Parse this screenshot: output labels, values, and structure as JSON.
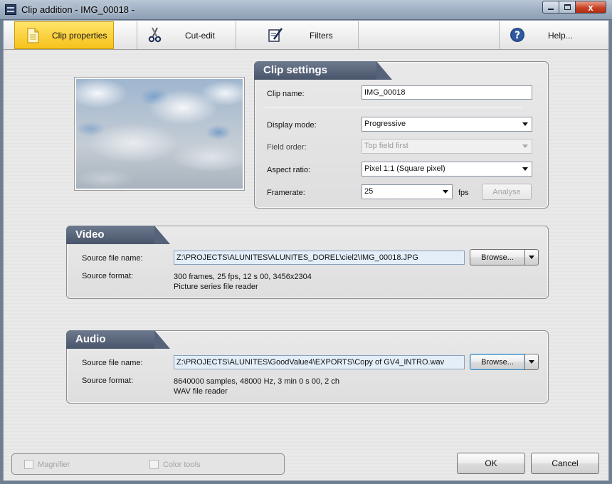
{
  "window": {
    "title": "Clip addition - IMG_00018 -",
    "icon": "app-icon",
    "controls": {
      "minimize": "minimize-icon",
      "maximize": "maximize-icon",
      "close": "x"
    }
  },
  "tabs": {
    "clip_properties": {
      "label": "Clip properties",
      "icon": "document-icon",
      "active": true
    },
    "cut_edit": {
      "label": "Cut-edit",
      "icon": "scissors-icon"
    },
    "filters": {
      "label": "Filters",
      "icon": "pen-icon"
    },
    "help": {
      "label": "Help...",
      "icon": "help-icon"
    }
  },
  "clip_settings": {
    "header": "Clip settings",
    "clip_name_label": "Clip name:",
    "clip_name_value": "IMG_00018",
    "display_mode_label": "Display mode:",
    "display_mode_value": "Progressive",
    "field_order_label": "Field order:",
    "field_order_value": "Top field first",
    "aspect_ratio_label": "Aspect ratio:",
    "aspect_ratio_value": "Pixel 1:1 (Square pixel)",
    "framerate_label": "Framerate:",
    "framerate_value": "25",
    "fps_unit": "fps",
    "analyse_label": "Analyse"
  },
  "video": {
    "header": "Video",
    "source_file_label": "Source file name:",
    "source_file_value": "Z:\\PROJECTS\\ALUNITES\\ALUNITES_DOREL\\ciel2\\IMG_00018.JPG",
    "browse_label": "Browse...",
    "source_format_label": "Source format:",
    "source_format_line1": "300  frames,  25  fps,  12 s 00,  3456x2304",
    "source_format_line2": "Picture series file reader"
  },
  "audio": {
    "header": "Audio",
    "source_file_label": "Source file name:",
    "source_file_value": "Z:\\PROJECTS\\ALUNITES\\GoodValue4\\EXPORTS\\Copy of GV4_INTRO.wav",
    "browse_label": "Browse...",
    "source_format_label": "Source format:",
    "source_format_line1": "8640000  samples,  48000  Hz,  3 min 0 s 00,  2 ch",
    "source_format_line2": "WAV file reader"
  },
  "footer": {
    "magnifier_label": "Magnifier",
    "color_tools_label": "Color tools",
    "ok_label": "OK",
    "cancel_label": "Cancel"
  },
  "colors": {
    "active_tab": "#f7c21b",
    "panel_header": "#48546a",
    "close_button": "#c94328"
  }
}
